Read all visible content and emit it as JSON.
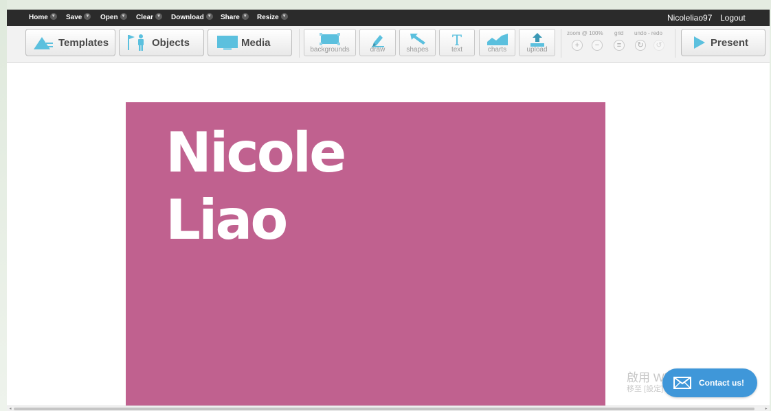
{
  "menubar": {
    "items": [
      {
        "label": "Home",
        "dropdown": "▾"
      },
      {
        "label": "Save",
        "dropdown": "▾"
      },
      {
        "label": "Open",
        "dropdown": "▾"
      },
      {
        "label": "Clear",
        "dropdown": "▾"
      },
      {
        "label": "Download",
        "dropdown": "▾"
      },
      {
        "label": "Share",
        "dropdown": "▾"
      },
      {
        "label": "Resize",
        "dropdown": "▾"
      }
    ],
    "username": "Nicoleliao97",
    "logout": "Logout"
  },
  "toolbar": {
    "templates": "Templates",
    "objects": "Objects",
    "media": "Media",
    "tools": [
      {
        "label": "backgrounds",
        "icon": "backgrounds-icon"
      },
      {
        "label": "draw",
        "icon": "pencil-icon"
      },
      {
        "label": "shapes",
        "icon": "arrow-shape-icon"
      },
      {
        "label": "text",
        "icon": "text-icon"
      },
      {
        "label": "charts",
        "icon": "chart-icon"
      },
      {
        "label": "upload",
        "icon": "upload-icon"
      }
    ],
    "zoom_label": "zoom @ 100%",
    "grid_label": "grid",
    "undo_redo_label": "undo - redo",
    "zoom_in": "+",
    "zoom_out": "−",
    "grid_symbol": "≡",
    "undo_symbol": "↻",
    "redo_symbol": "↺",
    "present": "Present"
  },
  "colors": {
    "accent": "#5bc0de",
    "slide_background": "#c0618f",
    "menubar": "#2b2b2b",
    "contact_button": "#3f97d9"
  },
  "slide": {
    "line1": "Nicole",
    "line2": "Liao"
  },
  "watermark": {
    "line1": "啟用 Windows",
    "line2": "移至 [設定] 以啟用 Windows。"
  },
  "contact": {
    "label": "Contact us!"
  },
  "scrollbar": {
    "left_arrow": "◂",
    "right_arrow": "▸"
  }
}
